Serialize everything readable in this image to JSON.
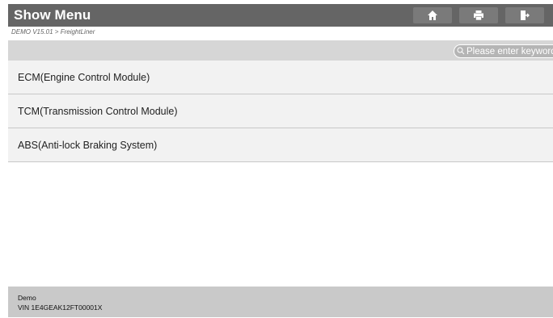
{
  "header": {
    "title": "Show Menu",
    "buttons": [
      {
        "name": "home",
        "icon": "home-icon"
      },
      {
        "name": "print",
        "icon": "printer-icon"
      },
      {
        "name": "exit",
        "icon": "exit-icon"
      }
    ]
  },
  "breadcrumb": "DEMO V15.01 > FreightLiner",
  "search": {
    "placeholder": "Please enter keyword"
  },
  "menu": {
    "items": [
      {
        "label": "ECM(Engine Control Module)"
      },
      {
        "label": "TCM(Transmission Control Module)"
      },
      {
        "label": "ABS(Anti-lock Braking System)"
      }
    ]
  },
  "footer": {
    "line1": "Demo",
    "line2": "VIN 1E4GEAK12FT00001X"
  },
  "colors": {
    "titlebar": "#656565",
    "search_bar": "#d6d6d6",
    "menu_item_bg": "#f2f2f2",
    "footer_bg": "#c9c9c9"
  }
}
